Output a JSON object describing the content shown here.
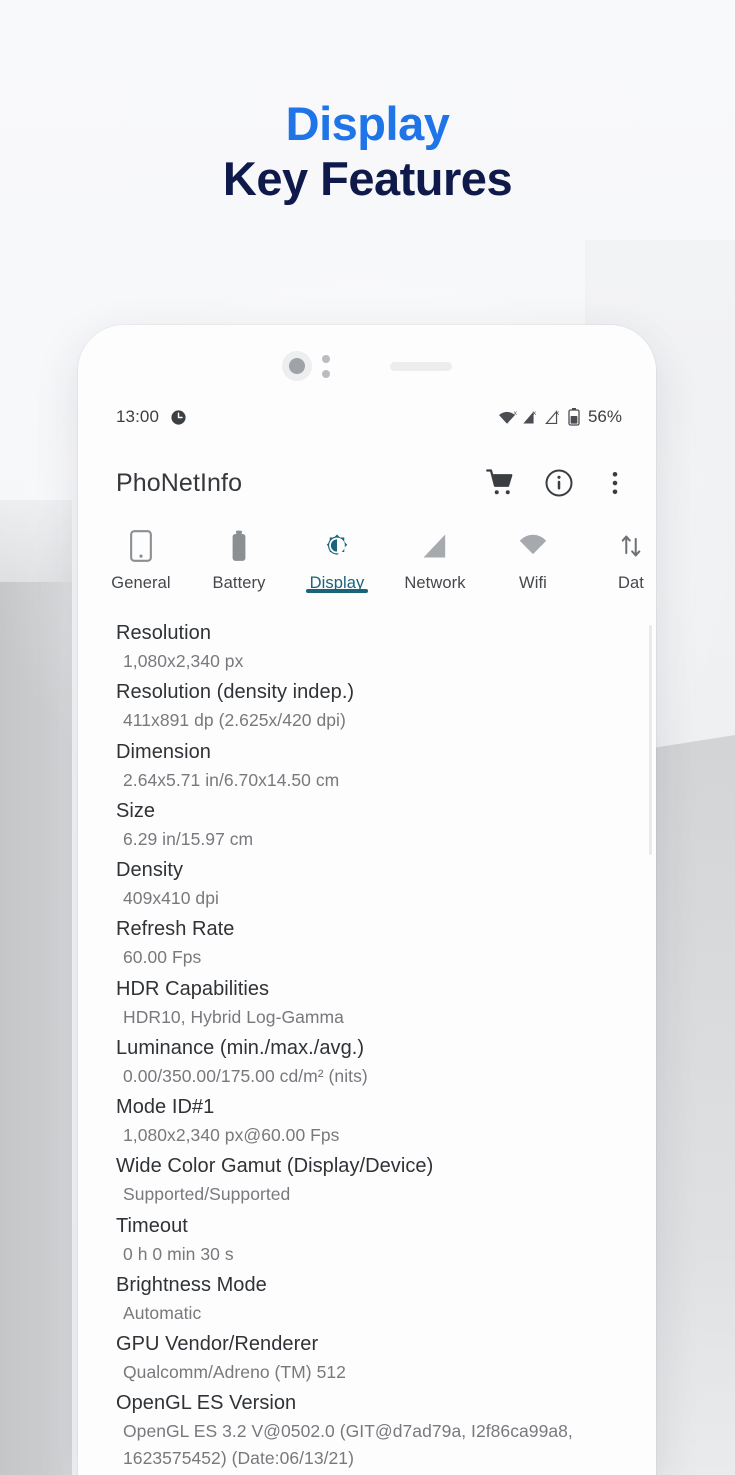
{
  "headline": {
    "line1": "Display",
    "line2": "Key Features",
    "accent_color": "#1f74e8",
    "dark_color": "#101a4a"
  },
  "phone": {
    "sensors": {
      "camera": "front-camera",
      "speaker": "earpiece-speaker"
    }
  },
  "statusbar": {
    "time": "13:00",
    "time_icon": "alarm-icon",
    "wifi_icon": "wifi-off-icon",
    "signal1_icon": "signal-no-sim-icon",
    "signal2_icon": "signal-no-sim-icon",
    "battery_icon": "battery-icon",
    "battery_percent": "56%"
  },
  "appbar": {
    "title": "PhoNetInfo",
    "actions": [
      {
        "name": "cart-icon",
        "label": "Shop"
      },
      {
        "name": "info-icon",
        "label": "About"
      },
      {
        "name": "overflow-menu-icon",
        "label": "More options"
      }
    ]
  },
  "tabs": {
    "active": "Display",
    "accent_color": "#19647a",
    "items": [
      {
        "label": "General",
        "icon": "phone-icon"
      },
      {
        "label": "Battery",
        "icon": "battery-icon"
      },
      {
        "label": "Display",
        "icon": "brightness-icon"
      },
      {
        "label": "Network",
        "icon": "signal-bars-icon"
      },
      {
        "label": "Wifi",
        "icon": "wifi-icon"
      },
      {
        "label": "Dat",
        "icon": "data-transfer-icon"
      }
    ]
  },
  "display_info": {
    "rows": [
      {
        "label": "Resolution",
        "value": "1,080x2,340 px"
      },
      {
        "label": "Resolution (density indep.)",
        "value": "411x891 dp (2.625x/420 dpi)"
      },
      {
        "label": "Dimension",
        "value": "2.64x5.71 in/6.70x14.50 cm"
      },
      {
        "label": "Size",
        "value": "6.29 in/15.97 cm"
      },
      {
        "label": "Density",
        "value": "409x410 dpi"
      },
      {
        "label": "Refresh Rate",
        "value": "60.00 Fps"
      },
      {
        "label": "HDR Capabilities",
        "value": "HDR10, Hybrid Log-Gamma"
      },
      {
        "label": "Luminance (min./max./avg.)",
        "value": "0.00/350.00/175.00 cd/m² (nits)"
      },
      {
        "label": "Mode ID#1",
        "value": "1,080x2,340 px@60.00 Fps"
      },
      {
        "label": "Wide Color Gamut (Display/Device)",
        "value": "Supported/Supported"
      },
      {
        "label": "Timeout",
        "value": "0 h 0 min 30 s"
      },
      {
        "label": "Brightness Mode",
        "value": "Automatic"
      },
      {
        "label": "GPU Vendor/Renderer",
        "value": "Qualcomm/Adreno (TM) 512"
      },
      {
        "label": "OpenGL ES Version",
        "value": "OpenGL ES 3.2 V@0502.0 (GIT@d7ad79a, I2f86ca99a8, 1623575452) (Date:06/13/21)"
      }
    ]
  }
}
